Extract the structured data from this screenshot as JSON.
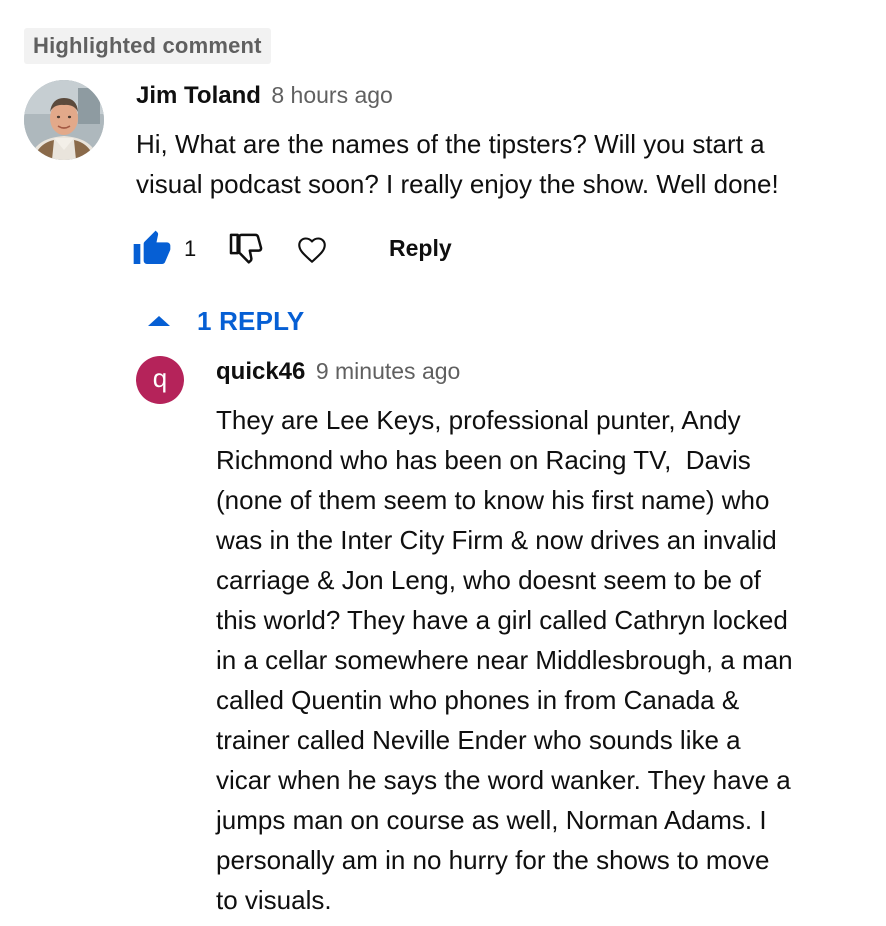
{
  "highlight_badge": "Highlighted comment",
  "comment": {
    "author": "Jim Toland",
    "time": "8 hours ago",
    "text_lines": [
      "Hi, What are the names of the tipsters? Will you start a",
      "visual podcast soon? I really enjoy the show. Well done!"
    ],
    "like_count": "1",
    "reply_label": "Reply",
    "like_state": "liked",
    "accent_color": "#065fd4"
  },
  "replies_toggle": {
    "label": "1 REPLY",
    "icon": "caret-up-icon"
  },
  "reply": {
    "avatar_letter": "q",
    "avatar_color": "#b5235a",
    "author": "quick46",
    "time": "9 minutes ago",
    "text_lines": [
      "They are Lee Keys, professional punter, Andy",
      "Richmond who has been on Racing TV,  Davis",
      "(none of them seem to know his first name) who",
      "was in the Inter City Firm & now drives an invalid",
      "carriage & Jon Leng, who doesnt seem to be of",
      "this world? They have a girl called Cathryn locked",
      "in a cellar somewhere near Middlesbrough, a man",
      "called Quentin who phones in from Canada &",
      "trainer called Neville Ender who sounds like a",
      "vicar when he says the word wanker. They have a",
      "jumps man on course as well, Norman Adams. I",
      "personally am in no hurry for the shows to move",
      "to visuals."
    ]
  }
}
